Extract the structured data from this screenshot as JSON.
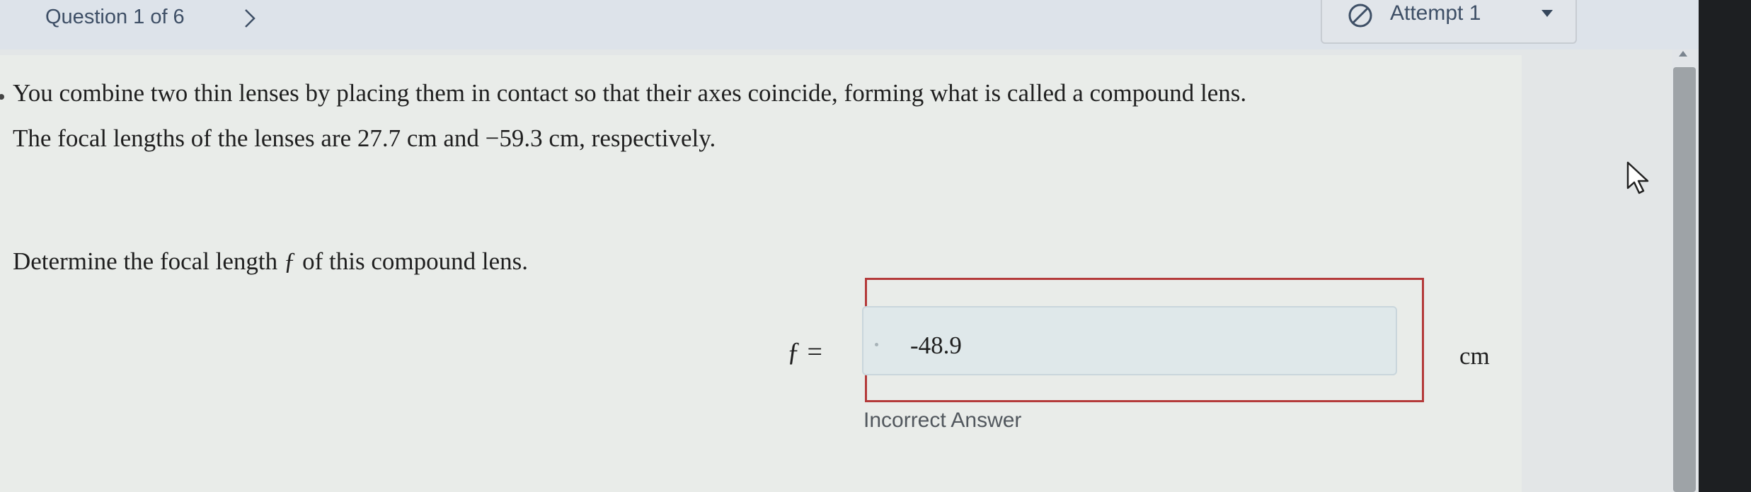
{
  "header": {
    "question_label": "Question 1 of 6",
    "attempt_label": "Attempt 1"
  },
  "question": {
    "line1": "You combine two thin lenses by placing them in contact so that their axes coincide, forming what is called a compound lens.",
    "line2": "The focal lengths of the lenses are 27.7 cm and −59.3 cm, respectively.",
    "prompt": "Determine the focal length ƒ of this compound lens."
  },
  "answer": {
    "variable": "ƒ =",
    "value": "-48.9",
    "unit": "cm",
    "feedback": "Incorrect Answer"
  },
  "colors": {
    "incorrect_border": "#b43a3a",
    "header_text": "#3e4f66"
  },
  "icons": {
    "next": "chevron-right-icon",
    "attempt": "cancel-circle-icon",
    "dropdown": "caret-down-icon"
  }
}
